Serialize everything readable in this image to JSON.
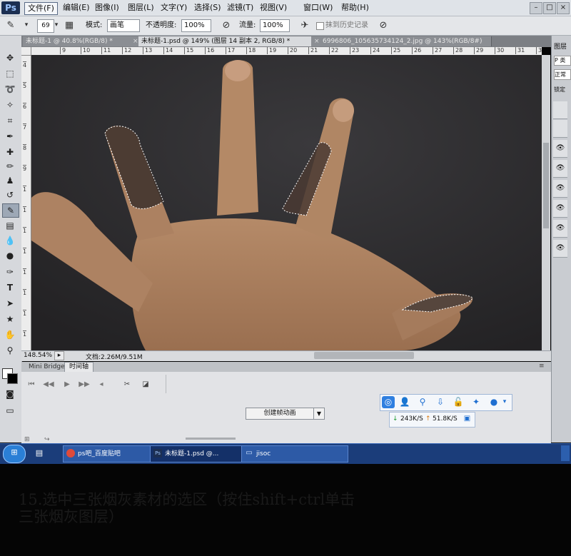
{
  "app": {
    "logo": "Ps",
    "menu": [
      "文件(F)",
      "编辑(E)",
      "图像(I)",
      "图层(L)",
      "文字(Y)",
      "选择(S)",
      "滤镜(T)",
      "视图(V)",
      "窗口(W)",
      "帮助(H)"
    ],
    "window_controls": [
      "–",
      "□",
      "×"
    ]
  },
  "options_bar": {
    "brush_size": "69",
    "mode_label": "模式:",
    "mode_value": "画笔",
    "opacity_label": "不透明度:",
    "opacity_value": "100%",
    "flow_label": "流量:",
    "flow_value": "100%",
    "erase_history_label": "抹到历史记录"
  },
  "tabs": [
    {
      "label": "未标题-1 @ 40.8%(RGB/8) *"
    },
    {
      "label": "未标题-1.psd @ 149% (图层 14 副本 2, RGB/8) *"
    },
    {
      "label": "6996806_105635734124_2.jpg @ 143%(RGB/8#)"
    }
  ],
  "ruler": {
    "h_ticks": [
      "9",
      "10",
      "11",
      "12",
      "13",
      "14",
      "15",
      "16",
      "17",
      "18",
      "19",
      "20",
      "21",
      "22",
      "23",
      "24",
      "25",
      "26",
      "27",
      "28",
      "29",
      "30",
      "31",
      "32"
    ],
    "v_ticks": [
      "4",
      "5",
      "6",
      "7",
      "8",
      "9",
      "1",
      "1",
      "1",
      "1",
      "1",
      "1",
      "1",
      "1"
    ]
  },
  "status": {
    "zoom": "148.54%",
    "doc": "文档:2.26M/9.51M"
  },
  "timeline": {
    "tabs": [
      "Mini Bridge",
      "时间轴"
    ],
    "create_button": "创建帧动画"
  },
  "right_panel": {
    "title": "图层",
    "search": "P 类",
    "blend": "正常",
    "lock": "锁定"
  },
  "widget": {
    "download_speed": "243K/S",
    "upload_speed": "51.8K/S"
  },
  "taskbar": {
    "items": [
      "ps吧_百度贴吧",
      "未标题-1.psd @...",
      "jisoc"
    ]
  },
  "caption": {
    "line1": "15.选中三张烟灰素材的选区（按住shift+ctrl单击",
    "line2": "三张烟灰图层）"
  }
}
